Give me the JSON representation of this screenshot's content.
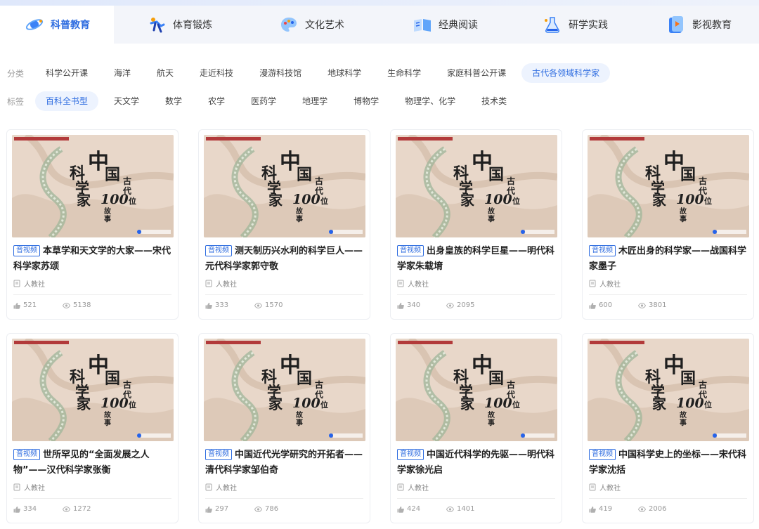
{
  "tabs": [
    {
      "label": "科普教育",
      "active": true,
      "icon": "atom-icon"
    },
    {
      "label": "体育锻炼",
      "active": false,
      "icon": "sports-icon"
    },
    {
      "label": "文化艺术",
      "active": false,
      "icon": "art-palette-icon"
    },
    {
      "label": "经典阅读",
      "active": false,
      "icon": "open-book-icon"
    },
    {
      "label": "研学实践",
      "active": false,
      "icon": "flask-icon"
    },
    {
      "label": "影视教育",
      "active": false,
      "icon": "video-play-icon"
    }
  ],
  "filters": {
    "category_label": "分类",
    "categories": [
      "科学公开课",
      "海洋",
      "航天",
      "走近科技",
      "漫游科技馆",
      "地球科学",
      "生命科学",
      "家庭科普公开课",
      "古代各领域科学家"
    ],
    "category_active": "古代各领域科学家",
    "tag_label": "标签",
    "tags": [
      "百科全书型",
      "天文学",
      "数学",
      "农学",
      "医药学",
      "地理学",
      "博物学",
      "物理学、化学",
      "技术类"
    ],
    "tag_active": "百科全书型"
  },
  "cover": {
    "title_chars": [
      "中",
      "国",
      "科",
      "学",
      "家",
      "古",
      "代",
      "100",
      "位",
      "故",
      "事"
    ],
    "bg_color": "#e8d7c9",
    "dark_color": "#1f1f1f",
    "red_color": "#b23a3a"
  },
  "cards": [
    {
      "badge": "音视频",
      "title": "本草学和天文学的大家——宋代科学家苏颂",
      "publisher": "人教社",
      "likes": "521",
      "views": "5138"
    },
    {
      "badge": "音视频",
      "title": "测天制历兴水利的科学巨人——元代科学家郭守敬",
      "publisher": "人教社",
      "likes": "333",
      "views": "1570"
    },
    {
      "badge": "音视频",
      "title": "出身皇族的科学巨星——明代科学家朱载堉",
      "publisher": "人教社",
      "likes": "340",
      "views": "2095"
    },
    {
      "badge": "音视频",
      "title": "木匠出身的科学家——战国科学家墨子",
      "publisher": "人教社",
      "likes": "600",
      "views": "3801"
    },
    {
      "badge": "音视频",
      "title": "世所罕见的“全面发展之人物”——汉代科学家张衡",
      "publisher": "人教社",
      "likes": "334",
      "views": "1272"
    },
    {
      "badge": "音视频",
      "title": "中国近代光学研究的开拓者——清代科学家邹伯奇",
      "publisher": "人教社",
      "likes": "297",
      "views": "786"
    },
    {
      "badge": "音视频",
      "title": "中国近代科学的先驱——明代科学家徐光启",
      "publisher": "人教社",
      "likes": "424",
      "views": "1401"
    },
    {
      "badge": "音视频",
      "title": "中国科学史上的坐标——宋代科学家沈括",
      "publisher": "人教社",
      "likes": "419",
      "views": "2006"
    }
  ]
}
